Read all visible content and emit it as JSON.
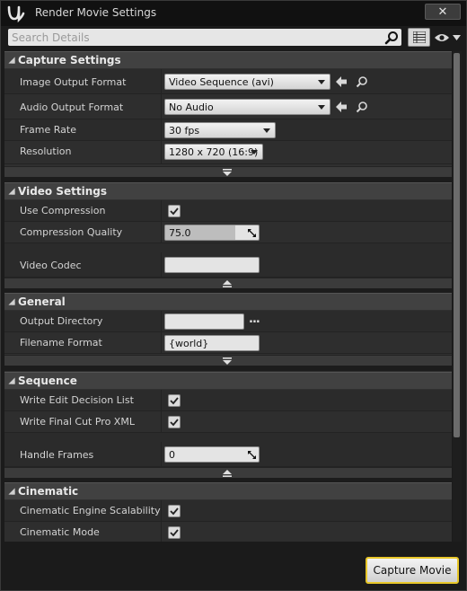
{
  "window": {
    "title": "Render Movie Settings",
    "close_label": "✕"
  },
  "search": {
    "placeholder": "Search Details",
    "value": ""
  },
  "categories": [
    {
      "label": "Capture Settings",
      "properties": [
        {
          "name": "Image Output Format",
          "value": "Video Sequence (avi)"
        },
        {
          "name": "Audio Output Format",
          "value": "No Audio"
        },
        {
          "name": "Frame Rate",
          "value": "30 fps"
        },
        {
          "name": "Resolution",
          "value": "1280 x 720 (16:9)"
        }
      ]
    },
    {
      "label": "Video Settings",
      "properties": [
        {
          "name": "Use Compression",
          "checked": true
        },
        {
          "name": "Compression Quality",
          "value": "75.0",
          "level": 0.75
        },
        {
          "name": "Video Codec",
          "value": ""
        }
      ]
    },
    {
      "label": "General",
      "properties": [
        {
          "name": "Output Directory",
          "value": "",
          "browse": "..."
        },
        {
          "name": "Filename Format",
          "value": "{world}"
        }
      ]
    },
    {
      "label": "Sequence",
      "properties": [
        {
          "name": "Write Edit Decision List",
          "checked": true
        },
        {
          "name": "Write Final Cut Pro XML",
          "checked": true
        },
        {
          "name": "Handle Frames",
          "value": "0"
        }
      ]
    },
    {
      "label": "Cinematic",
      "properties": [
        {
          "name": "Cinematic Engine Scalability",
          "checked": true
        },
        {
          "name": "Cinematic Mode",
          "checked": true
        }
      ]
    }
  ],
  "footer": {
    "capture_label": "Capture Movie"
  },
  "colors": {
    "accent": "#e8c72a",
    "panel": "#303030",
    "header": "#414141"
  }
}
